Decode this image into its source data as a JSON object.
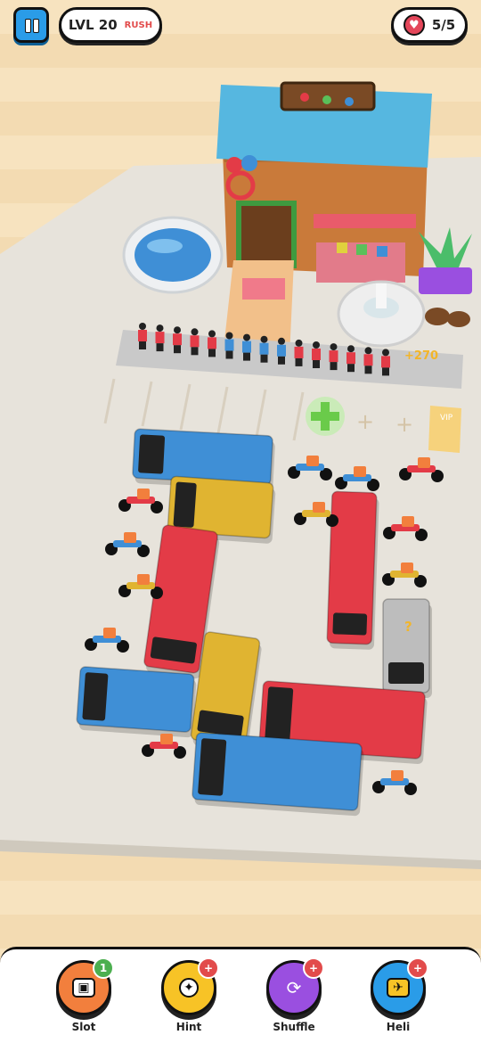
{
  "hud": {
    "level_label": "LVL 20",
    "mode_label": "RUSH",
    "lives_label": "5/5"
  },
  "game": {
    "bonus_text": "+270",
    "vip_label": "VIP",
    "mystery_label": "?",
    "colors": {
      "blue": "#3f8fd6",
      "yellow": "#e0b431",
      "red": "#e33b47",
      "gray": "#bdbdbd",
      "board": "#e7e3db"
    }
  },
  "tools": [
    {
      "name": "Slot",
      "badge": "1",
      "color": "#f27f3d",
      "badge_color": "#4caf50",
      "icon": "slot-icon"
    },
    {
      "name": "Hint",
      "badge": "+",
      "color": "#f7c326",
      "badge_color": "#e24b4b",
      "icon": "bulb-icon"
    },
    {
      "name": "Shuffle",
      "badge": "+",
      "color": "#9a4fe0",
      "badge_color": "#e24b4b",
      "icon": "shuffle-icon"
    },
    {
      "name": "Heli",
      "badge": "+",
      "color": "#2a9ce8",
      "badge_color": "#e24b4b",
      "icon": "helicopter-icon"
    }
  ]
}
